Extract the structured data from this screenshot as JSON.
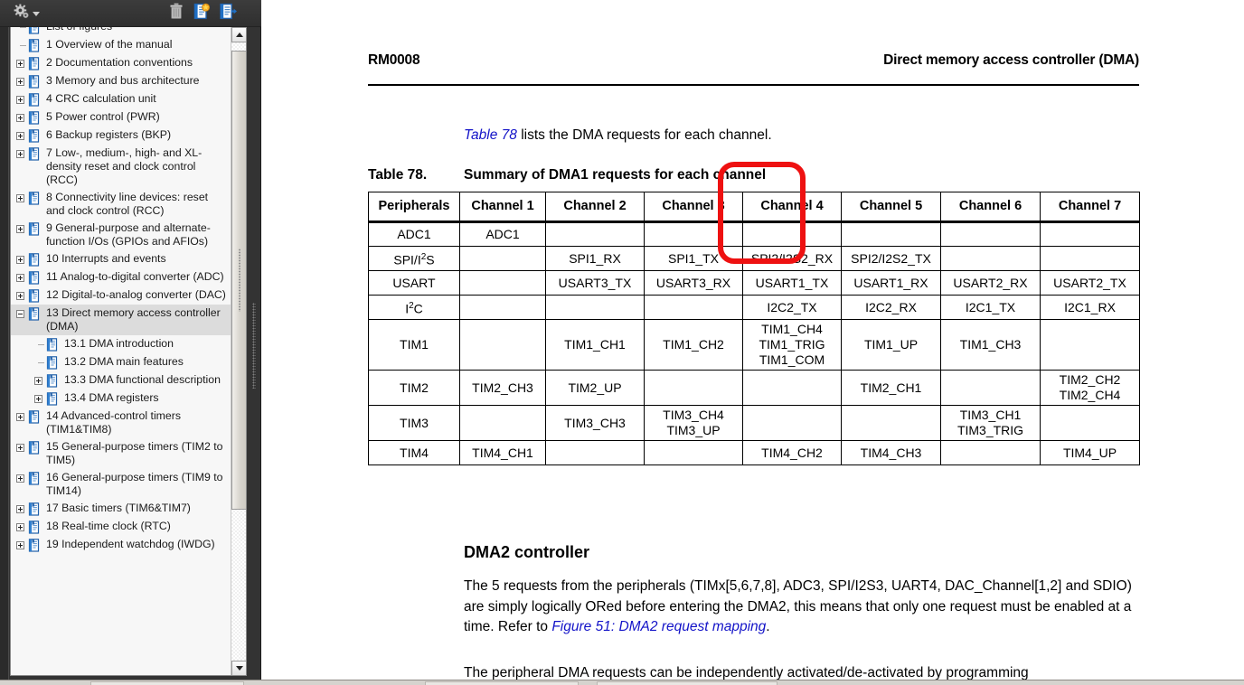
{
  "bookmark_panel": {
    "toolbar": {
      "options_label": "options-gear",
      "buttons": [
        {
          "name": "options-gear-icon",
          "tooltip": "Options"
        },
        {
          "name": "delete-bookmark-icon",
          "tooltip": "Delete"
        },
        {
          "name": "new-bookmark-icon",
          "tooltip": "New Bookmark"
        },
        {
          "name": "goto-bookmark-icon",
          "tooltip": "Go to Bookmark"
        }
      ]
    },
    "items": [
      {
        "label": "List of figures",
        "level": 0,
        "expander": "none",
        "selected": false
      },
      {
        "label": "1 Overview of the manual",
        "level": 0,
        "expander": "none",
        "selected": false
      },
      {
        "label": "2 Documentation conventions",
        "level": 0,
        "expander": "plus",
        "selected": false
      },
      {
        "label": "3 Memory and bus architecture",
        "level": 0,
        "expander": "plus",
        "selected": false
      },
      {
        "label": "4 CRC calculation unit",
        "level": 0,
        "expander": "plus",
        "selected": false
      },
      {
        "label": "5 Power control (PWR)",
        "level": 0,
        "expander": "plus",
        "selected": false
      },
      {
        "label": "6 Backup registers (BKP)",
        "level": 0,
        "expander": "plus",
        "selected": false
      },
      {
        "label": "7 Low-, medium-, high- and XL-density reset and clock control (RCC)",
        "level": 0,
        "expander": "plus",
        "selected": false
      },
      {
        "label": "8 Connectivity line devices: reset and clock control (RCC)",
        "level": 0,
        "expander": "plus",
        "selected": false
      },
      {
        "label": "9 General-purpose and alternate-function I/Os (GPIOs and AFIOs)",
        "level": 0,
        "expander": "plus",
        "selected": false
      },
      {
        "label": "10 Interrupts and events",
        "level": 0,
        "expander": "plus",
        "selected": false
      },
      {
        "label": "11 Analog-to-digital converter (ADC)",
        "level": 0,
        "expander": "plus",
        "selected": false
      },
      {
        "label": "12 Digital-to-analog converter (DAC)",
        "level": 0,
        "expander": "plus",
        "selected": false
      },
      {
        "label": "13 Direct memory access controller (DMA)",
        "level": 0,
        "expander": "minus",
        "selected": true
      },
      {
        "label": "13.1 DMA introduction",
        "level": 1,
        "expander": "none",
        "selected": false
      },
      {
        "label": "13.2 DMA main features",
        "level": 1,
        "expander": "none",
        "selected": false
      },
      {
        "label": "13.3 DMA functional description",
        "level": 1,
        "expander": "plus",
        "selected": false
      },
      {
        "label": "13.4 DMA registers",
        "level": 1,
        "expander": "plus",
        "selected": false
      },
      {
        "label": "14 Advanced-control timers (TIM1&TIM8)",
        "level": 0,
        "expander": "plus",
        "selected": false
      },
      {
        "label": "15 General-purpose timers (TIM2 to TIM5)",
        "level": 0,
        "expander": "plus",
        "selected": false
      },
      {
        "label": "16 General-purpose timers (TIM9 to TIM14)",
        "level": 0,
        "expander": "plus",
        "selected": false
      },
      {
        "label": "17 Basic timers (TIM6&TIM7)",
        "level": 0,
        "expander": "plus",
        "selected": false
      },
      {
        "label": "18 Real-time clock (RTC)",
        "level": 0,
        "expander": "plus",
        "selected": false
      },
      {
        "label": "19 Independent watchdog (IWDG)",
        "level": 0,
        "expander": "plus",
        "selected": false
      }
    ],
    "scrollbar": {
      "up_arrow": "scroll-up",
      "down_arrow": "scroll-down"
    }
  },
  "document": {
    "header_left": "RM0008",
    "header_right": "Direct memory access controller (DMA)",
    "intro": {
      "link": "Table 78",
      "rest": " lists the DMA requests for each channel."
    },
    "table_caption": {
      "number": "Table 78.",
      "title": "Summary of DMA1 requests for each channel"
    },
    "table": {
      "columns": [
        "Peripherals",
        "Channel 1",
        "Channel 2",
        "Channel 3",
        "Channel 4",
        "Channel 5",
        "Channel 6",
        "Channel 7"
      ],
      "rows": [
        [
          "ADC1",
          "ADC1",
          "",
          "",
          "",
          "",
          "",
          ""
        ],
        [
          "SPI/I2S",
          "",
          "SPI1_RX",
          "SPI1_TX",
          "SPI2/I2S2_RX",
          "SPI2/I2S2_TX",
          "",
          ""
        ],
        [
          "USART",
          "",
          "USART3_TX",
          "USART3_RX",
          "USART1_TX",
          "USART1_RX",
          "USART2_RX",
          "USART2_TX"
        ],
        [
          "I2C",
          "",
          "",
          "",
          "I2C2_TX",
          "I2C2_RX",
          "I2C1_TX",
          "I2C1_RX"
        ],
        [
          "TIM1",
          "",
          "TIM1_CH1",
          "TIM1_CH2",
          "TIM1_CH4\nTIM1_TRIG\nTIM1_COM",
          "TIM1_UP",
          "TIM1_CH3",
          ""
        ],
        [
          "TIM2",
          "TIM2_CH3",
          "TIM2_UP",
          "",
          "",
          "TIM2_CH1",
          "",
          "TIM2_CH2\nTIM2_CH4"
        ],
        [
          "TIM3",
          "",
          "TIM3_CH3",
          "TIM3_CH4\nTIM3_UP",
          "",
          "",
          "TIM3_CH1\nTIM3_TRIG",
          ""
        ],
        [
          "TIM4",
          "TIM4_CH1",
          "",
          "",
          "TIM4_CH2",
          "TIM4_CH3",
          "",
          "TIM4_UP"
        ]
      ]
    },
    "section_heading": "DMA2 controller",
    "paragraph_1": {
      "before_link": "The 5 requests from the peripherals (TIMx[5,6,7,8], ADC3, SPI/I2S3, UART4, DAC_Channel[1,2] and SDIO) are simply logically ORed before entering the DMA2, this means that only one request must be enabled at a time. Refer to ",
      "link": "Figure 51: DMA2 request mapping",
      "after_link": "."
    },
    "paragraph_2": "The peripheral DMA requests can be independently activated/de-activated by programming"
  },
  "annotation": {
    "name": "red-highlight-rectangle",
    "color": "#ee1111"
  }
}
